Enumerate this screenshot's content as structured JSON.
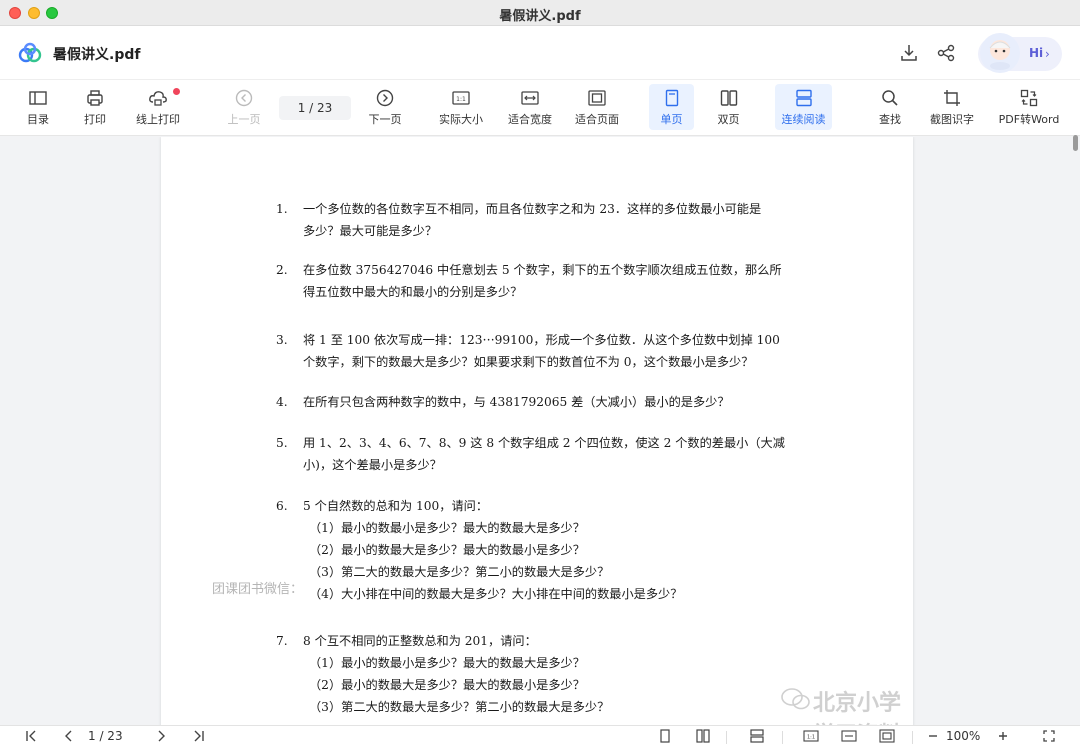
{
  "window": {
    "title": "暑假讲义.pdf"
  },
  "header": {
    "doc_title": "暑假讲义.pdf",
    "hi_label": "Hi"
  },
  "toolbar": {
    "toc": "目录",
    "print": "打印",
    "online_print": "线上打印",
    "prev_page": "上一页",
    "page_indicator": "1  /  23",
    "next_page": "下一页",
    "actual_size": "实际大小",
    "fit_width": "适合宽度",
    "fit_page": "适合页面",
    "single_page": "单页",
    "double_page": "双页",
    "continuous": "连续阅读",
    "find": "查找",
    "ocr": "截图识字",
    "pdf_to_word": "PDF转Word"
  },
  "document": {
    "questions": [
      {
        "num": "1.",
        "lines": [
          "一个多位数的各位数字互不相同，而且各位数字之和为 23．这样的多位数最小可能是",
          "多少？最大可能是多少？"
        ],
        "subs": []
      },
      {
        "num": "2.",
        "lines": [
          "在多位数 3756427046 中任意划去 5 个数字，剩下的五个数字顺次组成五位数，那么所",
          "得五位数中最大的和最小的分别是多少？"
        ],
        "subs": []
      },
      {
        "num": "3.",
        "lines": [
          "将 1 至 100 依次写成一排：123⋯99100，形成一个多位数．从这个多位数中划掉 100",
          "个数字，剩下的数最大是多少？如果要求剩下的数首位不为 0，这个数最小是多少？"
        ],
        "subs": []
      },
      {
        "num": "4.",
        "lines": [
          "在所有只包含两种数字的数中，与 4381792065 差（大减小）最小的是多少？"
        ],
        "subs": []
      },
      {
        "num": "5.",
        "lines": [
          "用 1、2、3、4、6、7、8、9 这 8 个数字组成 2 个四位数，使这 2 个数的差最小（大减",
          "小)，这个差最小是多少？"
        ],
        "subs": []
      },
      {
        "num": "6.",
        "lines": [
          "5 个自然数的总和为 100，请问："
        ],
        "subs": [
          "（1）最小的数最小是多少？最大的数最大是多少？",
          "（2）最小的数最大是多少？最大的数最小是多少？",
          "（3）第二大的数最大是多少？第二小的数最大是多少？",
          "（4）大小排在中间的数最大是多少？大小排在中间的数最小是多少？"
        ]
      },
      {
        "num": "7.",
        "lines": [
          "8 个互不相同的正整数总和为 201，请问："
        ],
        "subs": [
          "（1）最小的数最小是多少？最大的数最大是多少？",
          "（2）最小的数最大是多少？最大的数最小是多少？",
          "（3）第二大的数最大是多少？第二小的数最大是多少？"
        ]
      }
    ],
    "watermark_left": "团课团书微信：",
    "watermark_right": "北京小学学习资料"
  },
  "bottombar": {
    "page_indicator": "1  /  23",
    "zoom": "100%"
  },
  "colors": {
    "accent": "#2f6fed",
    "active_bg": "#eaf2ff",
    "badge": "#f0455b"
  }
}
